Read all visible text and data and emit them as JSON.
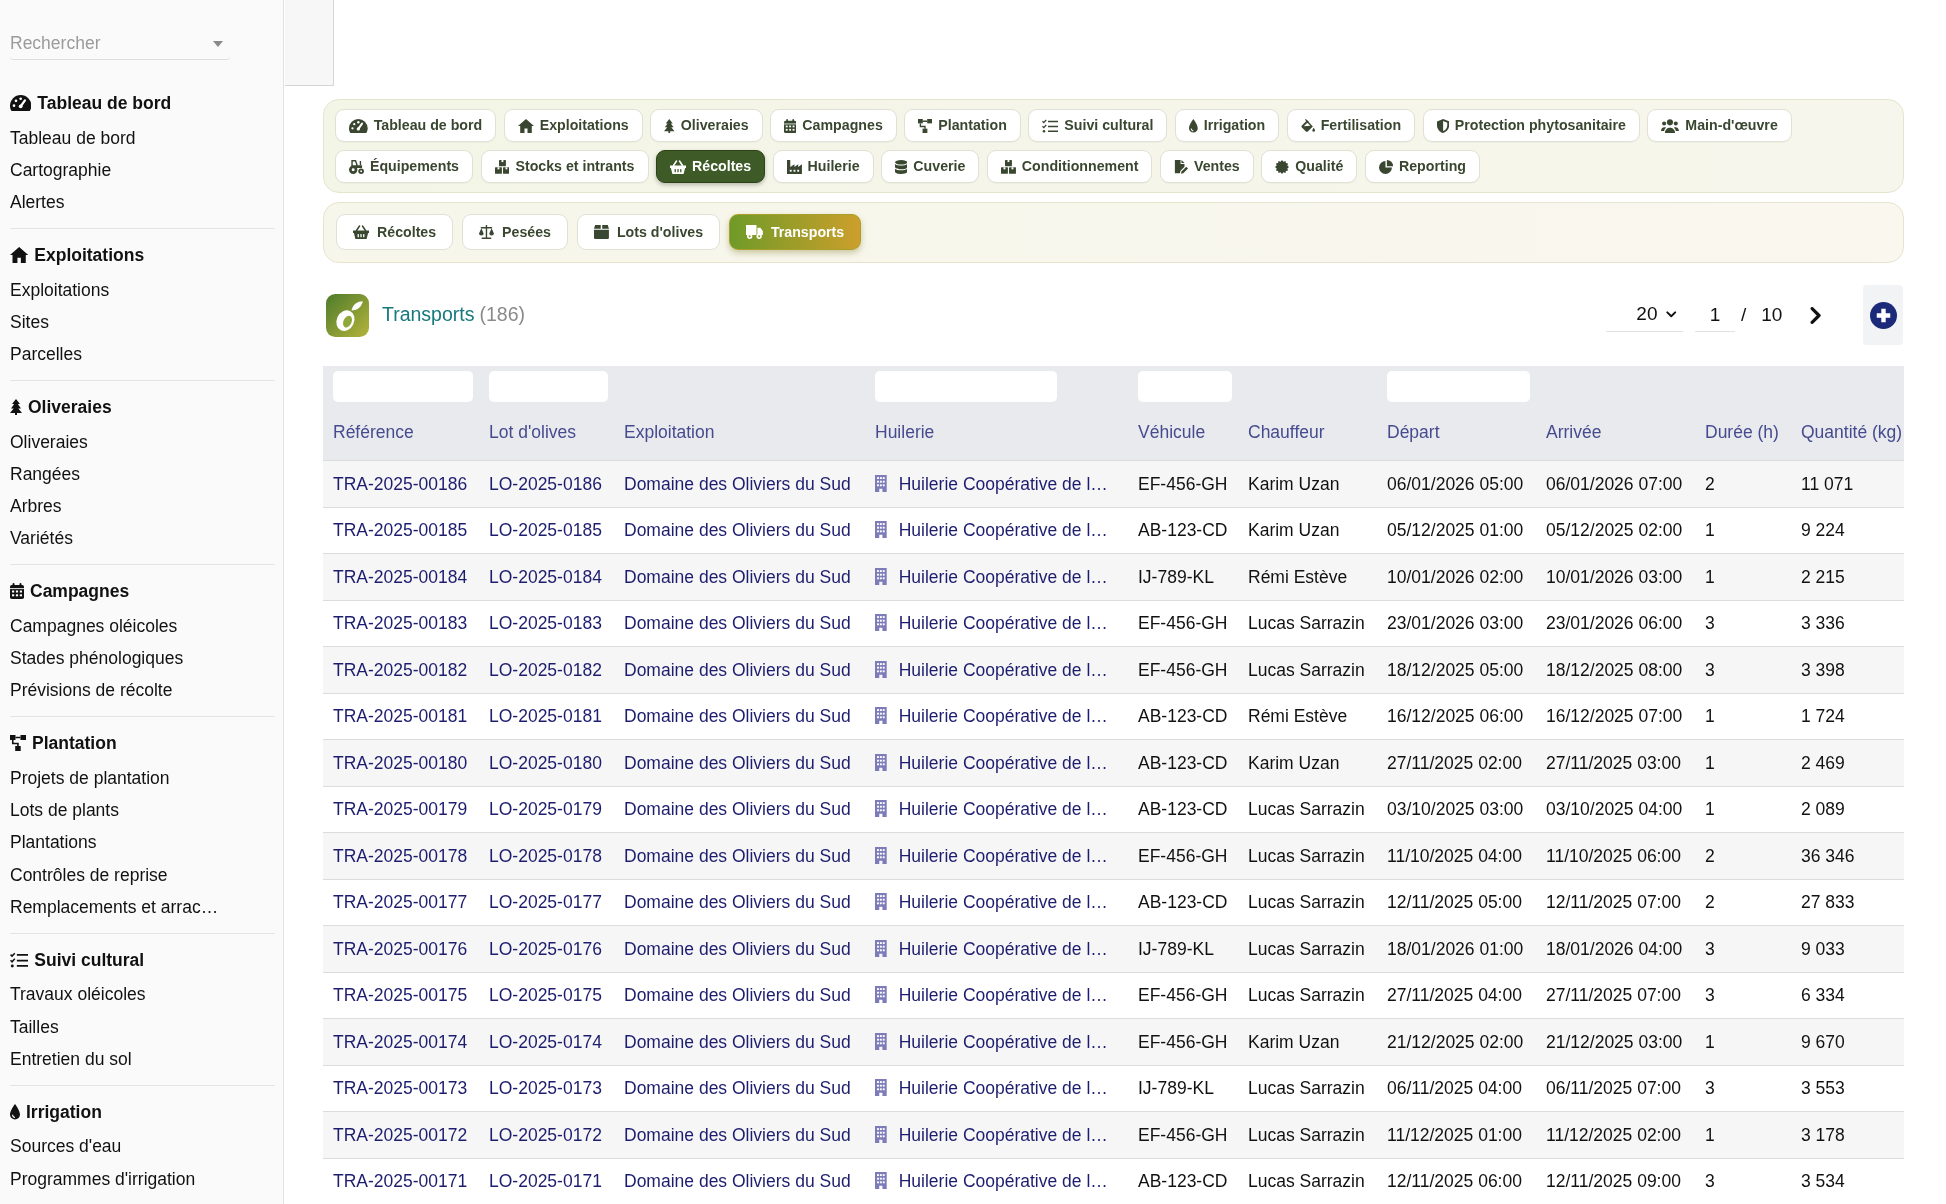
{
  "sidebar": {
    "search": {
      "placeholder": "Rechercher"
    },
    "sections": [
      {
        "title": "Tableau de bord",
        "items": [
          "Tableau de bord",
          "Cartographie",
          "Alertes"
        ]
      },
      {
        "title": "Exploitations",
        "items": [
          "Exploitations",
          "Sites",
          "Parcelles"
        ]
      },
      {
        "title": "Oliveraies",
        "items": [
          "Oliveraies",
          "Rangées",
          "Arbres",
          "Variétés"
        ]
      },
      {
        "title": "Campagnes",
        "items": [
          "Campagnes oléicoles",
          "Stades phénologiques",
          "Prévisions de récolte"
        ]
      },
      {
        "title": "Plantation",
        "items": [
          "Projets de plantation",
          "Lots de plants",
          "Plantations",
          "Contrôles de reprise",
          "Remplacements et arrac…"
        ]
      },
      {
        "title": "Suivi cultural",
        "items": [
          "Travaux oléicoles",
          "Tailles",
          "Entretien du sol"
        ]
      },
      {
        "title": "Irrigation",
        "items": [
          "Sources d'eau",
          "Programmes d'irrigation"
        ]
      }
    ]
  },
  "module_tabs": [
    {
      "label": "Tableau de bord",
      "selected": false
    },
    {
      "label": "Exploitations",
      "selected": false
    },
    {
      "label": "Oliveraies",
      "selected": false
    },
    {
      "label": "Campagnes",
      "selected": false
    },
    {
      "label": "Plantation",
      "selected": false
    },
    {
      "label": "Suivi cultural",
      "selected": false
    },
    {
      "label": "Irrigation",
      "selected": false
    },
    {
      "label": "Fertilisation",
      "selected": false
    },
    {
      "label": "Protection phytosanitaire",
      "selected": false
    },
    {
      "label": "Main-d'œuvre",
      "selected": false
    },
    {
      "label": "Équipements",
      "selected": false
    },
    {
      "label": "Stocks et intrants",
      "selected": false
    },
    {
      "label": "Récoltes",
      "selected": true
    },
    {
      "label": "Huilerie",
      "selected": false
    },
    {
      "label": "Cuverie",
      "selected": false
    },
    {
      "label": "Conditionnement",
      "selected": false
    },
    {
      "label": "Ventes",
      "selected": false
    },
    {
      "label": "Qualité",
      "selected": false
    },
    {
      "label": "Reporting",
      "selected": false
    }
  ],
  "sub_tabs": [
    {
      "label": "Récoltes",
      "selected": false
    },
    {
      "label": "Pesées",
      "selected": false
    },
    {
      "label": "Lots d'olives",
      "selected": false
    },
    {
      "label": "Transports",
      "selected": true
    }
  ],
  "list_header": {
    "title": "Transports",
    "count": "(186)",
    "page_size": {
      "value": "20"
    },
    "page": {
      "value": "1"
    },
    "separator": "/",
    "page_count": "10"
  },
  "table": {
    "columns": [
      {
        "label": "Référence",
        "kind": "link",
        "filter": true
      },
      {
        "label": "Lot d'olives",
        "kind": "link",
        "filter": true
      },
      {
        "label": "Exploitation",
        "kind": "link",
        "filter": false
      },
      {
        "label": "Huilerie",
        "kind": "facility",
        "filter": true
      },
      {
        "label": "Véhicule",
        "kind": "text",
        "filter": true
      },
      {
        "label": "Chauffeur",
        "kind": "text",
        "filter": false
      },
      {
        "label": "Départ",
        "kind": "text",
        "filter": true
      },
      {
        "label": "Arrivée",
        "kind": "text",
        "filter": false
      },
      {
        "label": "Durée (h)",
        "kind": "text",
        "filter": false
      },
      {
        "label": "Quantité (kg)",
        "kind": "text",
        "filter": false
      }
    ],
    "rows": [
      [
        "TRA-2025-00186",
        "LO-2025-0186",
        "Domaine des Oliviers du Sud",
        "Huilerie Coopérative de l…",
        "EF-456-GH",
        "Karim Uzan",
        "06/01/2026 05:00",
        "06/01/2026 07:00",
        "2",
        "11 071"
      ],
      [
        "TRA-2025-00185",
        "LO-2025-0185",
        "Domaine des Oliviers du Sud",
        "Huilerie Coopérative de l…",
        "AB-123-CD",
        "Karim Uzan",
        "05/12/2025 01:00",
        "05/12/2025 02:00",
        "1",
        "9 224"
      ],
      [
        "TRA-2025-00184",
        "LO-2025-0184",
        "Domaine des Oliviers du Sud",
        "Huilerie Coopérative de l…",
        "IJ-789-KL",
        "Rémi Estève",
        "10/01/2026 02:00",
        "10/01/2026 03:00",
        "1",
        "2 215"
      ],
      [
        "TRA-2025-00183",
        "LO-2025-0183",
        "Domaine des Oliviers du Sud",
        "Huilerie Coopérative de l…",
        "EF-456-GH",
        "Lucas Sarrazin",
        "23/01/2026 03:00",
        "23/01/2026 06:00",
        "3",
        "3 336"
      ],
      [
        "TRA-2025-00182",
        "LO-2025-0182",
        "Domaine des Oliviers du Sud",
        "Huilerie Coopérative de l…",
        "EF-456-GH",
        "Lucas Sarrazin",
        "18/12/2025 05:00",
        "18/12/2025 08:00",
        "3",
        "3 398"
      ],
      [
        "TRA-2025-00181",
        "LO-2025-0181",
        "Domaine des Oliviers du Sud",
        "Huilerie Coopérative de l…",
        "AB-123-CD",
        "Rémi Estève",
        "16/12/2025 06:00",
        "16/12/2025 07:00",
        "1",
        "1 724"
      ],
      [
        "TRA-2025-00180",
        "LO-2025-0180",
        "Domaine des Oliviers du Sud",
        "Huilerie Coopérative de l…",
        "AB-123-CD",
        "Karim Uzan",
        "27/11/2025 02:00",
        "27/11/2025 03:00",
        "1",
        "2 469"
      ],
      [
        "TRA-2025-00179",
        "LO-2025-0179",
        "Domaine des Oliviers du Sud",
        "Huilerie Coopérative de l…",
        "AB-123-CD",
        "Lucas Sarrazin",
        "03/10/2025 03:00",
        "03/10/2025 04:00",
        "1",
        "2 089"
      ],
      [
        "TRA-2025-00178",
        "LO-2025-0178",
        "Domaine des Oliviers du Sud",
        "Huilerie Coopérative de l…",
        "EF-456-GH",
        "Lucas Sarrazin",
        "11/10/2025 04:00",
        "11/10/2025 06:00",
        "2",
        "36 346"
      ],
      [
        "TRA-2025-00177",
        "LO-2025-0177",
        "Domaine des Oliviers du Sud",
        "Huilerie Coopérative de l…",
        "AB-123-CD",
        "Lucas Sarrazin",
        "12/11/2025 05:00",
        "12/11/2025 07:00",
        "2",
        "27 833"
      ],
      [
        "TRA-2025-00176",
        "LO-2025-0176",
        "Domaine des Oliviers du Sud",
        "Huilerie Coopérative de l…",
        "IJ-789-KL",
        "Lucas Sarrazin",
        "18/01/2026 01:00",
        "18/01/2026 04:00",
        "3",
        "9 033"
      ],
      [
        "TRA-2025-00175",
        "LO-2025-0175",
        "Domaine des Oliviers du Sud",
        "Huilerie Coopérative de l…",
        "EF-456-GH",
        "Lucas Sarrazin",
        "27/11/2025 04:00",
        "27/11/2025 07:00",
        "3",
        "6 334"
      ],
      [
        "TRA-2025-00174",
        "LO-2025-0174",
        "Domaine des Oliviers du Sud",
        "Huilerie Coopérative de l…",
        "EF-456-GH",
        "Karim Uzan",
        "21/12/2025 02:00",
        "21/12/2025 03:00",
        "1",
        "9 670"
      ],
      [
        "TRA-2025-00173",
        "LO-2025-0173",
        "Domaine des Oliviers du Sud",
        "Huilerie Coopérative de l…",
        "IJ-789-KL",
        "Lucas Sarrazin",
        "06/11/2025 04:00",
        "06/11/2025 07:00",
        "3",
        "3 553"
      ],
      [
        "TRA-2025-00172",
        "LO-2025-0172",
        "Domaine des Oliviers du Sud",
        "Huilerie Coopérative de l…",
        "EF-456-GH",
        "Lucas Sarrazin",
        "11/12/2025 01:00",
        "11/12/2025 02:00",
        "1",
        "3 178"
      ],
      [
        "TRA-2025-00171",
        "LO-2025-0171",
        "Domaine des Oliviers du Sud",
        "Huilerie Coopérative de l…",
        "AB-123-CD",
        "Lucas Sarrazin",
        "12/11/2025 06:00",
        "12/11/2025 09:00",
        "3",
        "3 534"
      ]
    ]
  }
}
